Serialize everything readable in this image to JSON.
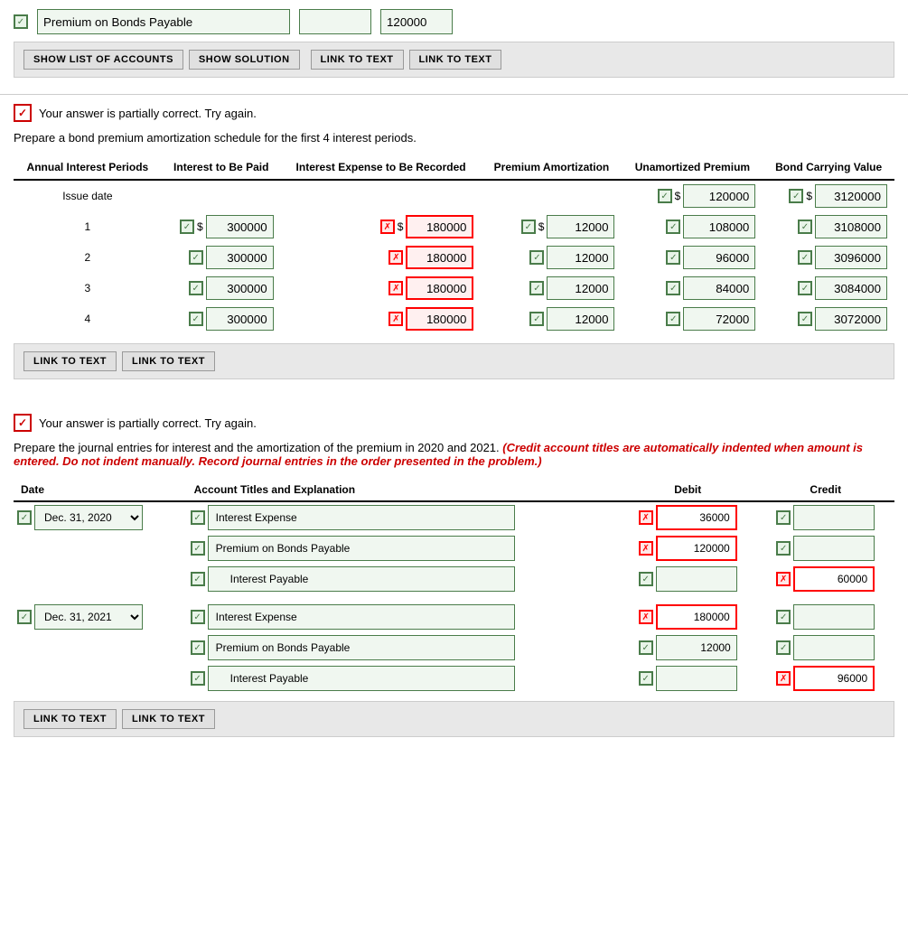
{
  "top": {
    "account_label": "Premium on Bonds Payable",
    "value1": "",
    "value2": "120000"
  },
  "toolbar1": {
    "btn1": "SHOW LIST OF ACCOUNTS",
    "btn2": "SHOW SOLUTION",
    "btn3": "LINK TO TEXT",
    "btn4": "LINK TO TEXT"
  },
  "section1": {
    "partial_msg": "Your answer is partially correct.  Try again.",
    "instruction": "Prepare a bond premium amortization schedule for the first 4 interest periods.",
    "table": {
      "headers": [
        "Annual Interest Periods",
        "Interest to Be Paid",
        "Interest Expense to Be Recorded",
        "Premium Amortization",
        "Unamortized Premium",
        "Bond Carrying Value"
      ],
      "issue_date": {
        "label": "Issue date",
        "unamortized": "120000",
        "carrying": "3120000"
      },
      "rows": [
        {
          "period": "1",
          "paid": "300000",
          "expense": "180000",
          "amortization": "12000",
          "unamortized": "108000",
          "carrying": "3108000",
          "expense_red": true
        },
        {
          "period": "2",
          "paid": "300000",
          "expense": "180000",
          "amortization": "12000",
          "unamortized": "96000",
          "carrying": "3096000",
          "expense_red": true
        },
        {
          "period": "3",
          "paid": "300000",
          "expense": "180000",
          "amortization": "12000",
          "unamortized": "84000",
          "carrying": "3084000",
          "expense_red": true
        },
        {
          "period": "4",
          "paid": "300000",
          "expense": "180000",
          "amortization": "12000",
          "unamortized": "72000",
          "carrying": "3072000",
          "expense_red": true
        }
      ]
    }
  },
  "toolbar2": {
    "btn1": "LINK TO TEXT",
    "btn2": "LINK TO TEXT"
  },
  "section2": {
    "partial_msg": "Your answer is partially correct.  Try again.",
    "instruction1": "Prepare the journal entries for interest and the amortization of the premium in 2020 and 2021.",
    "instruction2": "(Credit account titles are automatically indented when amount is entered. Do not indent manually. Record journal entries in the order presented in the problem.)",
    "table": {
      "headers": [
        "Date",
        "Account Titles and Explanation",
        "Debit",
        "Credit"
      ],
      "groups": [
        {
          "date": "Dec. 31, 2020",
          "rows": [
            {
              "account": "Interest Expense",
              "debit": "36000",
              "credit": "",
              "debit_red": true,
              "credit_green": true
            },
            {
              "account": "Premium on Bonds Payable",
              "debit": "120000",
              "credit": "",
              "debit_red": true,
              "credit_green": true
            },
            {
              "account": "Interest Payable",
              "debit": "",
              "credit": "60000",
              "debit_green": true,
              "credit_red": true
            }
          ]
        },
        {
          "date": "Dec. 31, 2021",
          "rows": [
            {
              "account": "Interest Expense",
              "debit": "180000",
              "credit": "",
              "debit_red": true,
              "credit_green": true
            },
            {
              "account": "Premium on Bonds Payable",
              "debit": "12000",
              "credit": "",
              "debit_red": false,
              "credit_green": true
            },
            {
              "account": "Interest Payable",
              "debit": "",
              "credit": "96000",
              "debit_green": true,
              "credit_red": true
            }
          ]
        }
      ]
    }
  },
  "toolbar3": {
    "btn1": "LINK TO TEXT",
    "btn2": "LINK TO TEXT"
  }
}
